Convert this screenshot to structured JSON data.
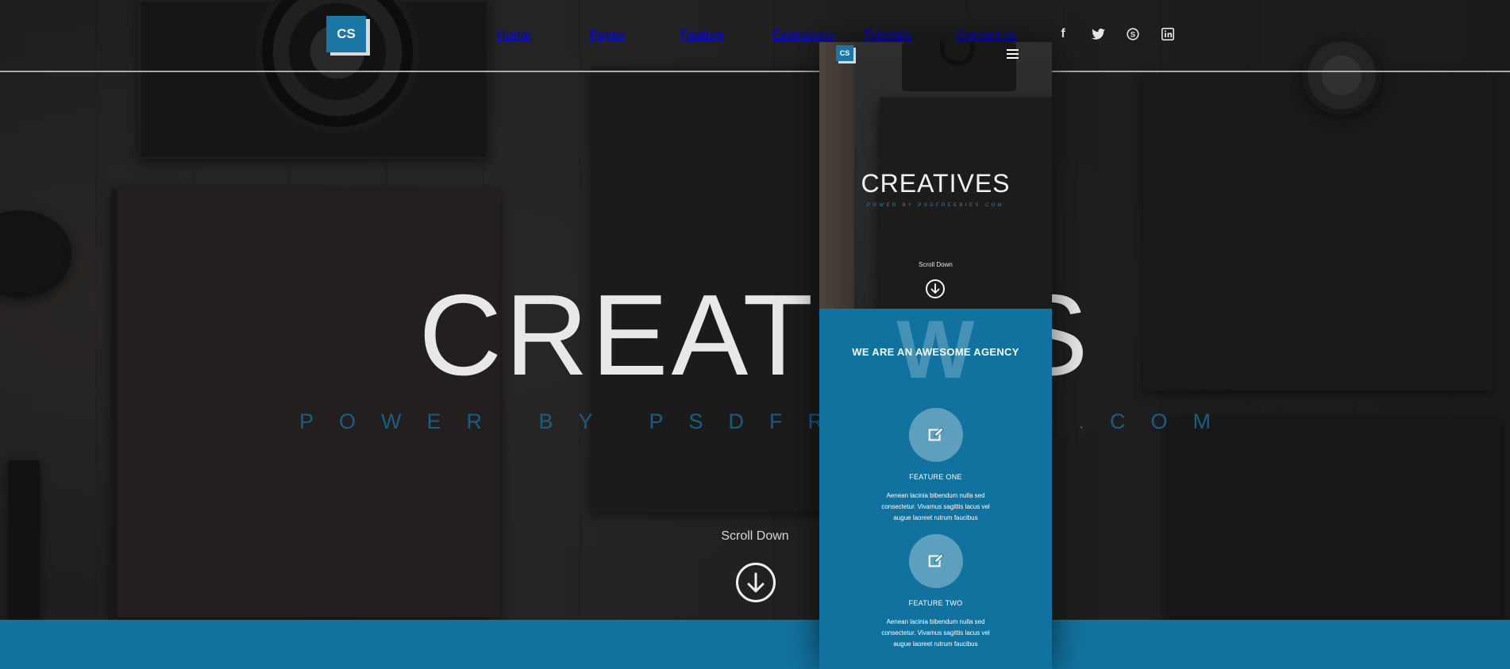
{
  "desktop": {
    "logo": "CS",
    "nav": [
      "Home",
      "Pages",
      "Feature",
      "Extensions",
      "Tutorials",
      "Contact us"
    ],
    "social_icons": [
      "facebook-icon",
      "twitter-icon",
      "skype-icon",
      "linkedin-icon"
    ],
    "hero": {
      "title": "CREATIVES",
      "subtitle": "POWER BY PSDFREEBIES.COM",
      "scroll_label": "Scroll Down"
    }
  },
  "mobile": {
    "logo": "CS",
    "menu_icon": "hamburger-icon",
    "hero": {
      "title": "CREATIVES",
      "subtitle": "POWER BY PSDFREEBIES.COM",
      "scroll_label": "Scroll Down"
    },
    "agency": {
      "ghost_letter": "W",
      "title": "WE ARE AN AWESOME AGENCY",
      "features": [
        {
          "icon": "edit-icon",
          "name": "FEATURE ONE",
          "text": "Aenean lacinia bibendum nulla sed consectetur. Vivamus sagittis lacus vel augue laoreet rutrum faucibus"
        },
        {
          "icon": "edit-icon",
          "name": "FEATURE TWO",
          "text": "Aenean lacinia bibendum nulla sed consectetur. Vivamus sagittis lacus vel augue laoreet rutrum faucibus"
        }
      ]
    }
  },
  "colors": {
    "accent_blue": "#12729f",
    "subtitle_blue": "#1a5d83"
  }
}
